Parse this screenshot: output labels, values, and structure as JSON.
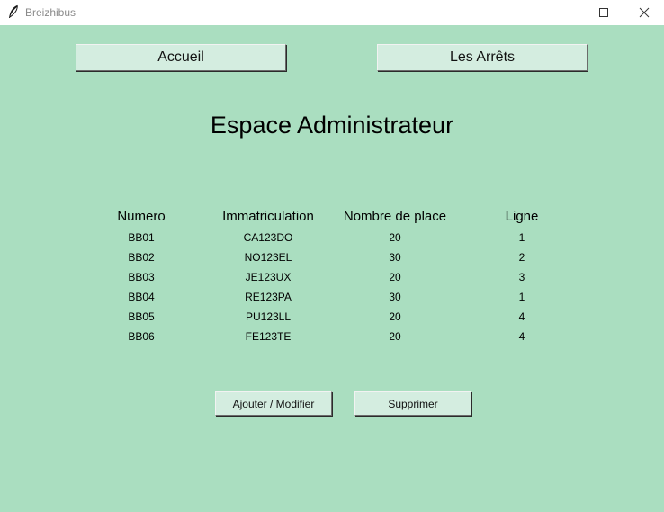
{
  "window": {
    "title": "Breizhibus",
    "icons": [
      "feather-icon",
      "minimize-icon",
      "maximize-icon",
      "close-icon"
    ]
  },
  "nav": {
    "home_label": "Accueil",
    "stops_label": "Les Arrêts"
  },
  "page": {
    "title": "Espace Administrateur"
  },
  "table": {
    "headers": [
      "Numero",
      "Immatriculation",
      "Nombre de place",
      "Ligne"
    ],
    "rows": [
      [
        "BB01",
        "CA123DO",
        "20",
        "1"
      ],
      [
        "BB02",
        "NO123EL",
        "30",
        "2"
      ],
      [
        "BB03",
        "JE123UX",
        "20",
        "3"
      ],
      [
        "BB04",
        "RE123PA",
        "30",
        "1"
      ],
      [
        "BB05",
        "PU123LL",
        "20",
        "4"
      ],
      [
        "BB06",
        "FE123TE",
        "20",
        "4"
      ]
    ]
  },
  "actions": {
    "add_modify_label": "Ajouter / Modifier",
    "delete_label": "Supprimer"
  },
  "colors": {
    "background": "#aadec0",
    "button": "#d4ede0"
  }
}
